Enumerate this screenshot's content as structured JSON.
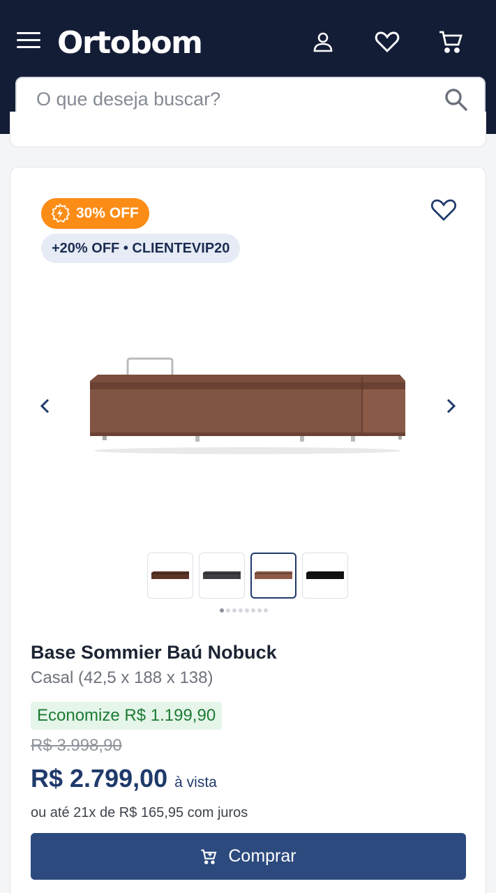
{
  "header": {
    "logo": "Ortobom",
    "search_placeholder": "O que deseja buscar?"
  },
  "product": {
    "discount_badge": "30% OFF",
    "coupon_badge": "+20% OFF • CLIENTEVIP20",
    "thumbnails": [
      {
        "color": "#5a3527"
      },
      {
        "color": "#3d3f43"
      },
      {
        "color": "#8d5b48"
      },
      {
        "color": "#111111"
      }
    ],
    "active_thumbnail": 3,
    "carousel_dots": 8,
    "active_dot": 1,
    "title": "Base Sommier Baú Nobuck",
    "subtitle": "Casal (42,5 x 188 x 138)",
    "saving": "Economize R$ 1.199,90",
    "old_price": "R$ 3.998,90",
    "price": "R$ 2.799,00",
    "price_suffix": "à vista",
    "installments": "ou até 21x de R$ 165,95 com juros",
    "buy_label": "Comprar"
  },
  "colors": {
    "header_bg": "#141d36",
    "badge_orange": "#fb8c16",
    "primary_blue": "#2c4a7e",
    "price_blue": "#1f3a6b",
    "saving_green": "#1d7a33"
  }
}
